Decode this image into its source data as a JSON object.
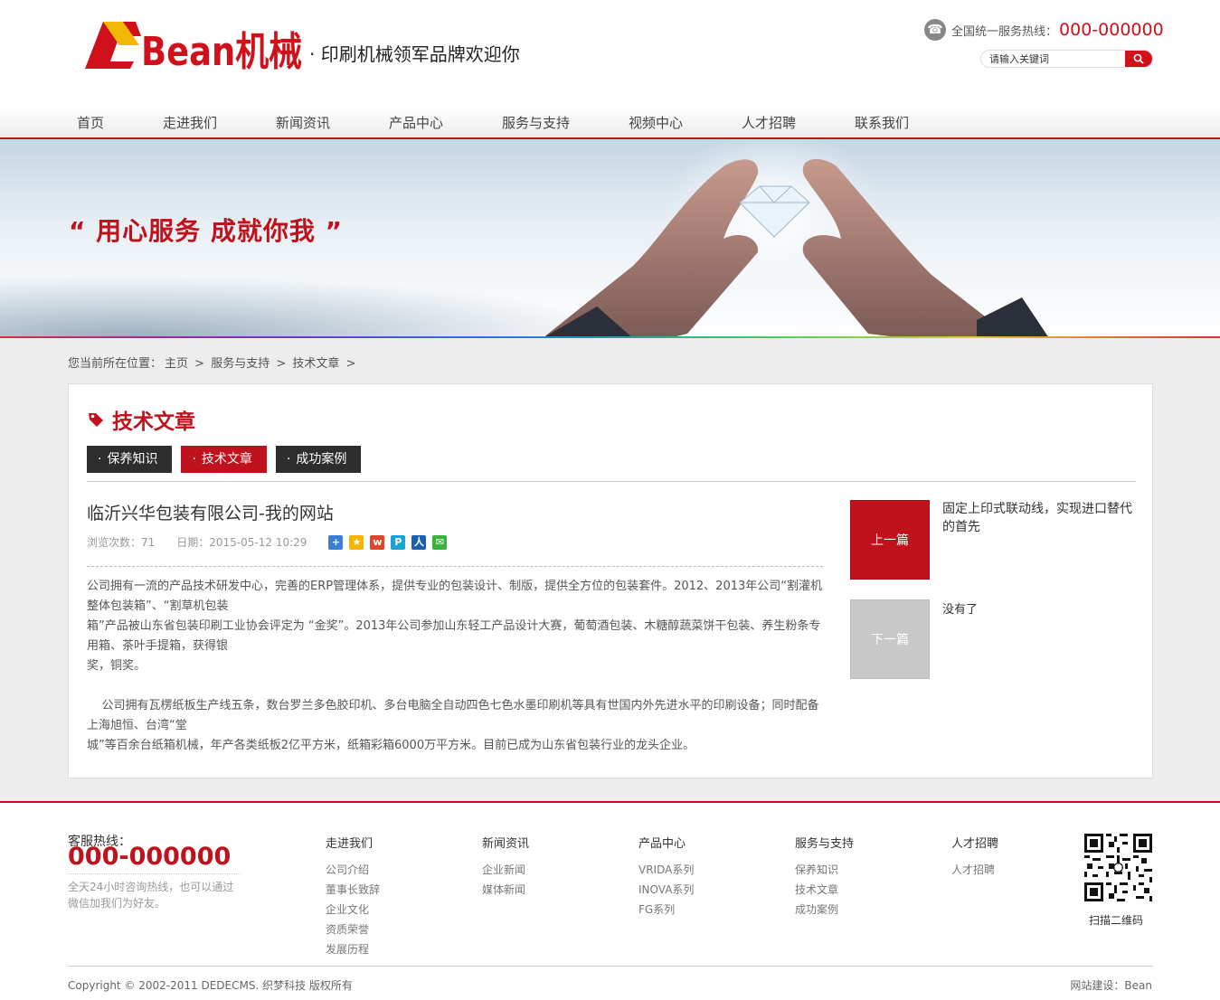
{
  "header": {
    "logo_text": "Bean机械",
    "slogan": "· 印刷机械领军品牌欢迎你",
    "hotline_label": "全国统一服务热线：",
    "hotline_number": "000-000000",
    "search_placeholder": "请输入关键词"
  },
  "nav": {
    "items": [
      "首页",
      "走进我们",
      "新闻资讯",
      "产品中心",
      "服务与支持",
      "视频中心",
      "人才招聘",
      "联系我们"
    ]
  },
  "banner": {
    "slogan": "“ 用心服务  成就你我 ”"
  },
  "breadcrumb": {
    "prefix": "您当前所在位置：",
    "home": "主页",
    "sep": ">",
    "level1": "服务与支持",
    "level2": "技术文章"
  },
  "section": {
    "title": "技术文章",
    "tabs": [
      {
        "label": "保养知识",
        "active": false
      },
      {
        "label": "技术文章",
        "active": true
      },
      {
        "label": "成功案例",
        "active": false
      }
    ]
  },
  "article": {
    "title": "临沂兴华包装有限公司-我的网站",
    "views": "浏览次数：71",
    "date": "日期：2015-05-12 10:29",
    "share_icons": [
      "share-plus-icon",
      "qzone-icon",
      "weibo-icon",
      "tencent-weibo-icon",
      "renren-icon",
      "wechat-icon"
    ],
    "paragraphs": [
      "公司拥有一流的产品技术研发中心，完善的ERP管理体系，提供专业的包装设计、制版，提供全方位的包装套件。2012、2013年公司“割灌机整体包装箱”、“割草机包装",
      "箱”产品被山东省包装印刷工业协会评定为 “金奖”。2013年公司参加山东轻工产品设计大赛，葡萄酒包装、木糖醇蔬菜饼干包装、养生粉条专用箱、茶叶手提箱，获得银",
      "奖，铜奖。",
      "    公司拥有瓦楞纸板生产线五条，数台罗兰多色胶印机、多台电脑全自动四色七色水墨印刷机等具有世国内外先进水平的印刷设备；同时配备上海旭恒、台湾“堂",
      "城”等百余台纸箱机械，年产各类纸板2亿平方米，纸箱彩箱6000万平方米。目前已成为山东省包装行业的龙头企业。"
    ]
  },
  "pager": {
    "prev_label": "上一篇",
    "prev_title": "固定上印式联动线，实现进口替代的首先",
    "next_label": "下一篇",
    "next_title": "没有了"
  },
  "footer": {
    "service_label": "客服热线：",
    "service_number": "000-000000",
    "service_desc": "全天24小时咨询热线，也可以通过微信加我们为好友。",
    "columns": [
      {
        "title": "走进我们",
        "links": [
          "公司介绍",
          "董事长致辞",
          "企业文化",
          "资质荣誉",
          "发展历程"
        ]
      },
      {
        "title": "新闻资讯",
        "links": [
          "企业新闻",
          "媒体新闻"
        ]
      },
      {
        "title": "产品中心",
        "links": [
          "VRIDA系列",
          "INOVA系列",
          "FG系列"
        ]
      },
      {
        "title": "服务与支持",
        "links": [
          "保养知识",
          "技术文章",
          "成功案例"
        ]
      },
      {
        "title": "人才招聘",
        "links": [
          "人才招聘"
        ]
      }
    ],
    "qr_label": "扫描二维码",
    "copyright": "Copyright © 2002-2011 DEDECMS. 织梦科技 版权所有",
    "builder": "网站建设：Bean"
  },
  "colors": {
    "brand_red": "#c0121c",
    "dark_tab": "#2d2d2d",
    "pager_disabled": "#c8c8c8"
  }
}
